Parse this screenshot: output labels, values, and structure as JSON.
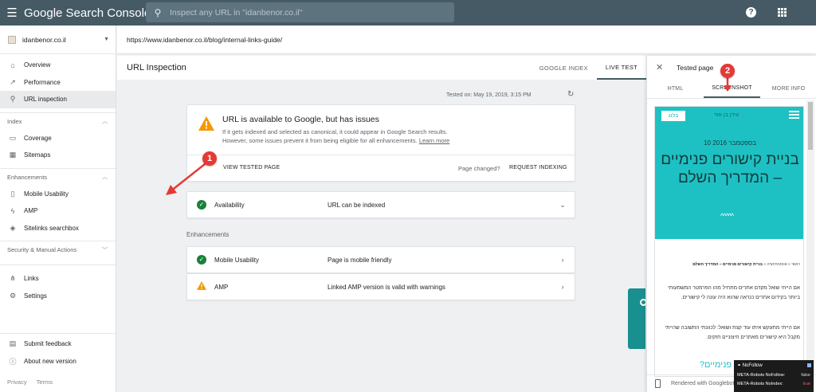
{
  "topbar": {
    "app_title": "Google Search Console",
    "search_placeholder": "Inspect any URL in \"idanbenor.co.il\""
  },
  "sidebar": {
    "property": "idanbenor.co.il",
    "primary": [
      {
        "label": "Overview",
        "icon": "home-icon"
      },
      {
        "label": "Performance",
        "icon": "trending-icon"
      },
      {
        "label": "URL inspection",
        "icon": "search-icon",
        "active": true
      }
    ],
    "sections": [
      {
        "title": "Index",
        "items": [
          {
            "label": "Coverage",
            "icon": "coverage-icon"
          },
          {
            "label": "Sitemaps",
            "icon": "sitemap-icon"
          }
        ]
      },
      {
        "title": "Enhancements",
        "items": [
          {
            "label": "Mobile Usability",
            "icon": "phone-icon"
          },
          {
            "label": "AMP",
            "icon": "bolt-icon"
          },
          {
            "label": "Sitelinks searchbox",
            "icon": "diamond-icon"
          }
        ]
      },
      {
        "title": "Security & Manual Actions",
        "items": []
      }
    ],
    "other": [
      {
        "label": "Links",
        "icon": "links-icon"
      },
      {
        "label": "Settings",
        "icon": "gear-icon"
      }
    ],
    "bottom": [
      {
        "label": "Submit feedback",
        "icon": "feedback-icon"
      },
      {
        "label": "About new version",
        "icon": "info-icon"
      }
    ],
    "footer": {
      "privacy": "Privacy",
      "terms": "Terms"
    }
  },
  "url_bar": {
    "url": "https://www.idanbenor.co.il/blog/internal-links-guide/"
  },
  "main": {
    "title": "URL Inspection",
    "tabs": [
      {
        "label": "GOOGLE INDEX"
      },
      {
        "label": "LIVE TEST",
        "active": true
      }
    ],
    "tested_on": "Tested on: May 19, 2019, 3:15 PM",
    "status": {
      "title": "URL is available to Google, but has issues",
      "desc_line1": "If it gets indexed and selected as canonical, it could appear in Google Search results.",
      "desc_line2": "However, some issues prevent it from being eligible for all enhancements.",
      "learn_more": "Learn more",
      "view_tested_page": "VIEW TESTED PAGE",
      "page_changed": "Page changed?",
      "request_indexing": "REQUEST INDEXING"
    },
    "availability": {
      "label": "Availability",
      "value": "URL can be indexed"
    },
    "enhancements_label": "Enhancements",
    "enhancements": [
      {
        "label": "Mobile Usability",
        "value": "Page is mobile friendly",
        "status": "ok"
      },
      {
        "label": "AMP",
        "value": "Linked AMP version is valid with warnings",
        "status": "warning"
      }
    ]
  },
  "panel": {
    "title": "Tested page",
    "tabs": [
      {
        "label": "HTML"
      },
      {
        "label": "SCREENSHOT",
        "active": true
      },
      {
        "label": "MORE INFO"
      }
    ],
    "screenshot": {
      "button": "בלוג",
      "logo": "עידן בן אור",
      "date": "10 בספטמבר 2016",
      "title": "בניית קישורים פנימיים – המדריך השלם",
      "wave": "^^^^^",
      "crumb_prefix": "ראשי » אופטימיזציה »",
      "crumb_current": "בניית קישורים פנימיים – המדריך השלם",
      "para1": "אם הייתי שואל מקדם אתרים מתחיל מהו הפרמטר המשמעותי ביותר בקידום אתרים כנראה שהוא היה עונה לי קישורים.",
      "para2": "אם הייתי מתעקש איתו עוד קצת ושואל: לכוונתי התשובה שהייתי מקבל היא קישורים מאתרים חיצוניים חזקים.",
      "heading": "למה צריך קישורים פנימיים?"
    },
    "rendered_with": "Rendered with Googlebot"
  },
  "extension": {
    "title": "NoFollow",
    "rows": [
      {
        "label": "META-Robots NoFollow:",
        "value": "false"
      },
      {
        "label": "META-Robots NoIndex:",
        "value": "true"
      }
    ]
  },
  "annotations": [
    {
      "label": "1"
    },
    {
      "label": "2"
    }
  ],
  "colors": {
    "topbar": "#455a64",
    "warning": "#f29900",
    "success": "#188038",
    "annotation": "#e53935",
    "screenshot_accent": "#1ec1c3"
  }
}
